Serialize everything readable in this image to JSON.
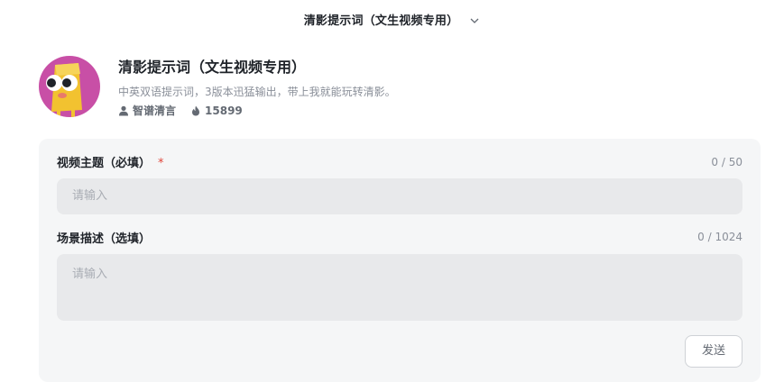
{
  "topbar": {
    "title": "清影提示词（文生视频专用）"
  },
  "agent": {
    "name": "清影提示词（文生视频专用）",
    "description": "中英双语提示词，3版本迅猛输出，带上我就能玩转清影。",
    "author": "智谱清言",
    "heat": "15899"
  },
  "form": {
    "fields": [
      {
        "label": "视频主题（必填）",
        "required_mark": "*",
        "counter": "0 / 50",
        "placeholder": "请输入"
      },
      {
        "label": "场景描述（选填）",
        "counter": "0 / 1024",
        "placeholder": "请输入"
      }
    ],
    "send_label": "发送"
  },
  "colors": {
    "card_bg": "#f5f6f7",
    "input_bg": "#e8e9eb",
    "required": "#e0453a",
    "avatar_bg": "#c84fa6",
    "avatar_figure": "#f2c230"
  }
}
